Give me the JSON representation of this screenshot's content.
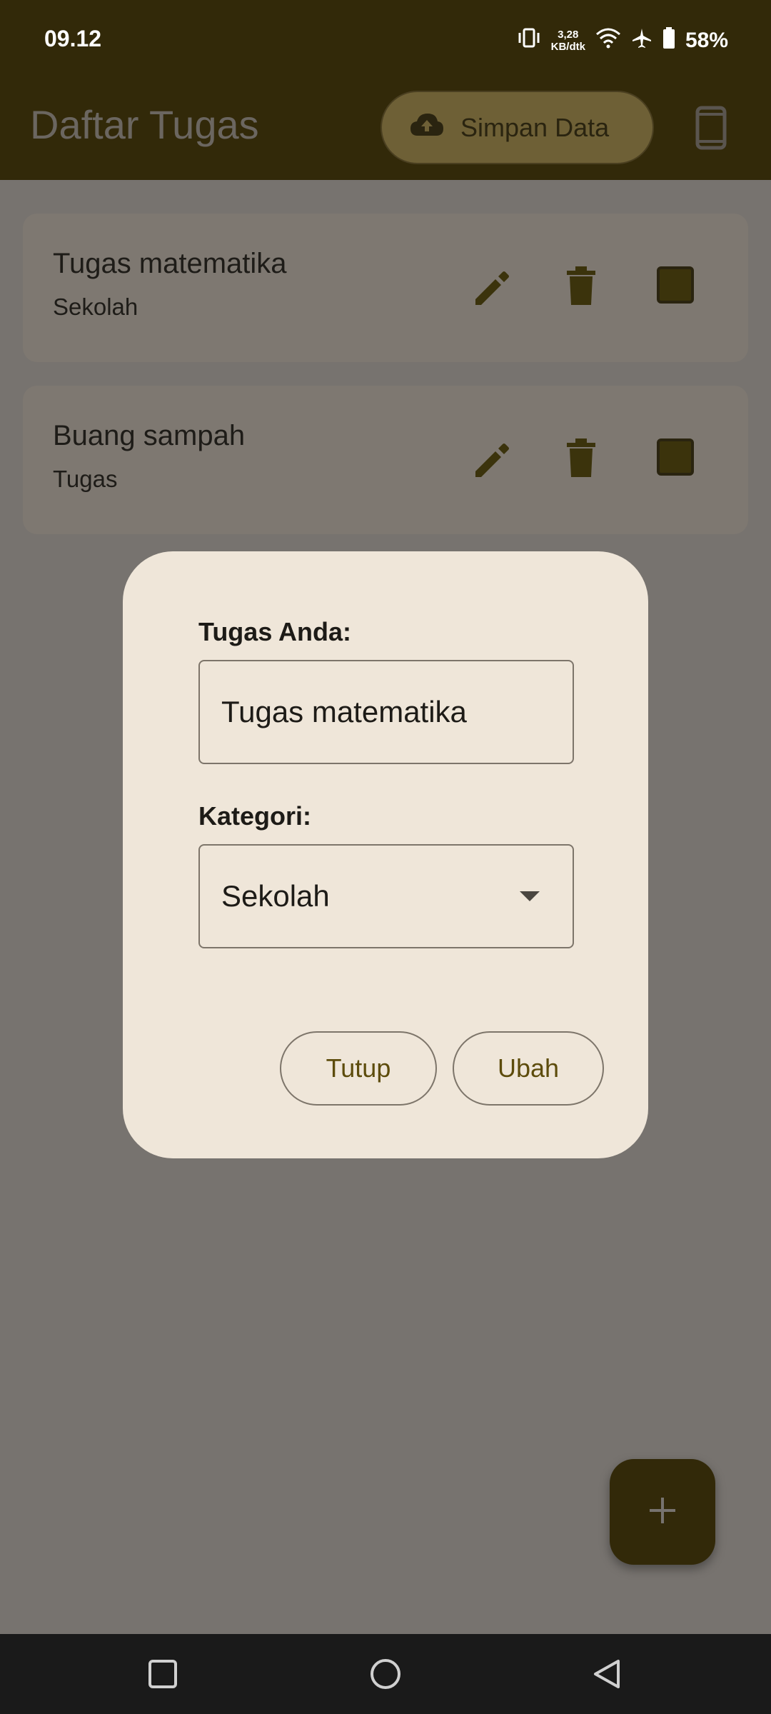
{
  "status_bar": {
    "time": "09.12",
    "net_speed_value": "3,28",
    "net_speed_unit": "KB/dtk",
    "battery_percent": "58%",
    "icons": [
      "vibrate-icon",
      "wifi-icon",
      "airplane-icon",
      "battery-icon"
    ]
  },
  "app_bar": {
    "title": "Daftar Tugas",
    "save_button_label": "Simpan Data",
    "save_icon": "cloud-upload-icon",
    "device_icon": "phone-icon"
  },
  "tasks": [
    {
      "title": "Tugas matematika",
      "category": "Sekolah"
    },
    {
      "title": "Buang sampah",
      "category": "Tugas"
    }
  ],
  "dialog": {
    "task_label": "Tugas Anda:",
    "task_value": "Tugas matematika",
    "category_label": "Kategori:",
    "category_value": "Sekolah",
    "close_button": "Tutup",
    "update_button": "Ubah"
  },
  "fab_icon": "plus-icon",
  "colors": {
    "app_bar": "#322909",
    "scrim": "#77736f",
    "dialog_bg": "#efe6d9",
    "accent_text": "#5d4c0c"
  }
}
